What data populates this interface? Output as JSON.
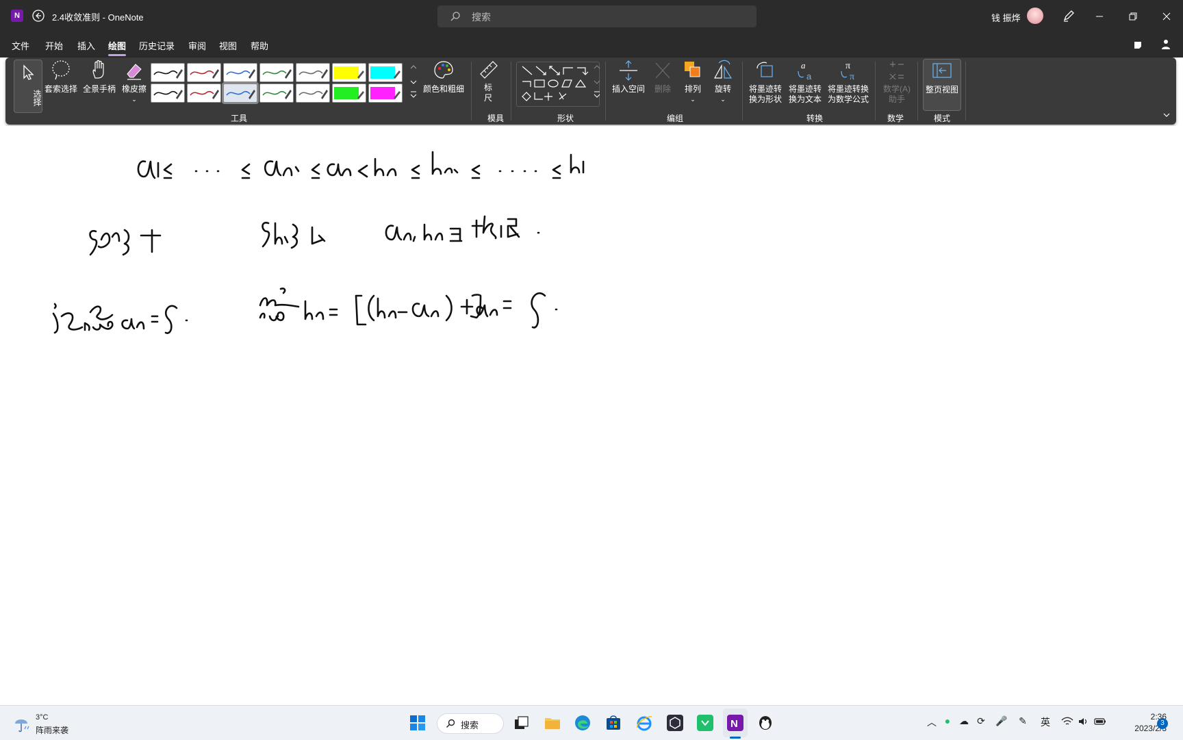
{
  "window": {
    "title": "2.4收敛准则 - OneNote",
    "app_icon_letter": "N",
    "search_placeholder": "搜索",
    "user_name": "钱 振烨"
  },
  "menu": {
    "items": [
      "文件",
      "开始",
      "插入",
      "绘图",
      "历史记录",
      "审阅",
      "视图",
      "帮助"
    ],
    "active": "绘图"
  },
  "ribbon": {
    "select": "选择",
    "lasso": "套索选择",
    "pan": "全景手柄",
    "eraser": "橡皮擦",
    "color_thickness": "颜色和粗细",
    "ruler": "标尺",
    "insert_space": "插入空间",
    "delete": "删除",
    "arrange": "排列",
    "rotate": "旋转",
    "ink_to_shape": "将墨迹转换为形状",
    "ink_to_text": "将墨迹转换为文本",
    "ink_to_math": "将墨迹转换为数学公式",
    "math_assistant": "数学(A)助手",
    "full_page_view": "整页视图",
    "groups": {
      "tools": "工具",
      "stencils": "模具",
      "shapes": "形状",
      "edit": "编组",
      "convert": "转换",
      "math": "数学",
      "mode": "模式"
    },
    "pen_colors_row1": [
      "#111111",
      "#c0222b",
      "#2a6fd6",
      "#2e8b3a",
      "#6a6a6a",
      "#ffff00",
      "#00ffff"
    ],
    "pen_colors_row2": [
      "#111111",
      "#c0222b",
      "#2a6fd6",
      "#2e8b3a",
      "#6a6a6a",
      "#22ee22",
      "#ff22ff"
    ]
  },
  "taskbar": {
    "weather_temp": "3°C",
    "weather_desc": "阵雨来袭",
    "search_label": "搜索",
    "input_method": "英",
    "time": "2:36",
    "date": "2023/2/3",
    "notification_count": "3"
  }
}
